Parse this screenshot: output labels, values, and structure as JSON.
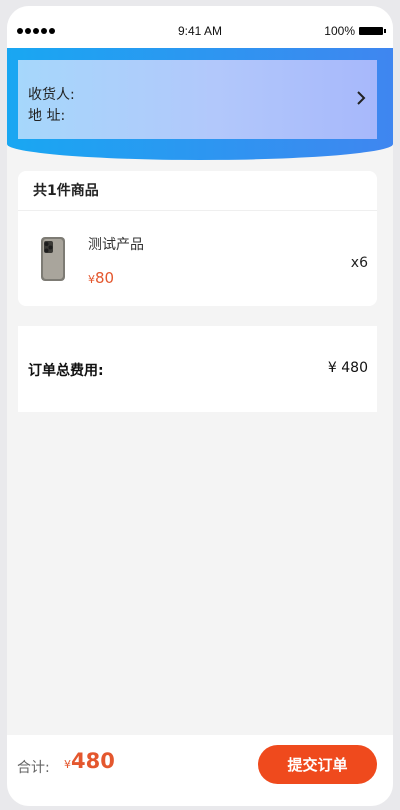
{
  "status_bar": {
    "time": "9:41 AM",
    "battery": "100%",
    "icons": [
      "signal-icon",
      "battery-icon"
    ]
  },
  "address": {
    "receiver_label": "收货人:",
    "address_label": "地 址:",
    "icon": "chevron-right-icon"
  },
  "product_section": {
    "header": "共1件商品",
    "items": [
      {
        "name": "测试产品",
        "price_symbol": "¥",
        "price": "80",
        "quantity": "x6",
        "thumbnail_icon": "phone-product-icon"
      }
    ]
  },
  "total": {
    "label": "订单总费用:",
    "value": "¥  480"
  },
  "footer": {
    "sum_label": "合计:",
    "sum_symbol": "¥",
    "sum_value": "480",
    "submit_label": "提交订单"
  },
  "colors": {
    "accent": "#ef4a1d",
    "price": "#e4572e",
    "header_gradient_start": "#19a7f2",
    "header_gradient_end": "#3f86f0",
    "background": "#f4f4f4"
  }
}
